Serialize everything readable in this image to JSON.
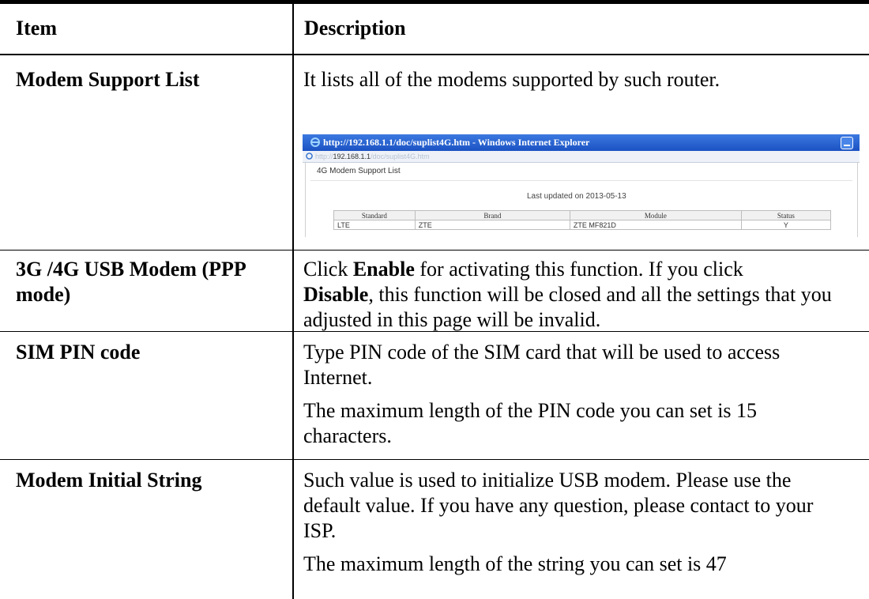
{
  "header": {
    "item": "Item",
    "description": "Description"
  },
  "rows": [
    {
      "item": "Modem Support List",
      "description": "It lists all of the modems supported by such router."
    },
    {
      "item_line1": "3G /4G USB Modem (PPP",
      "item_line2": "mode)",
      "desc_prefix": "Click ",
      "desc_bold1": "Enable",
      "desc_mid": " for activating this function. If you click",
      "desc_bold2": "Disable",
      "desc_suffix": ", this function will be closed and all the settings that you adjusted in this page will be invalid."
    },
    {
      "item": "SIM PIN code",
      "desc_p1": "Type PIN code of the SIM card that will be used to access Internet.",
      "desc_p2": "The maximum length of the PIN code you can set is 15 characters."
    },
    {
      "item": "Modem Initial String",
      "desc_p1": "Such value is used to initialize USB modem. Please use the default value. If you have any question, please contact to your ISP.",
      "desc_p2": "The maximum length of the string you can set is 47"
    }
  ],
  "browser": {
    "title": "http://192.168.1.1/doc/suplist4G.htm - Windows Internet Explorer",
    "address_host": "192.168.1.1",
    "address_path": "/doc/suplist4G.htm",
    "page_heading": "4G Modem Support List",
    "last_updated": "Last updated on 2013-05-13",
    "table": {
      "columns": [
        "Standard",
        "Brand",
        "Module",
        "Status"
      ],
      "rows": [
        [
          "LTE",
          "ZTE",
          "ZTE MF821D",
          "Y"
        ]
      ]
    }
  }
}
